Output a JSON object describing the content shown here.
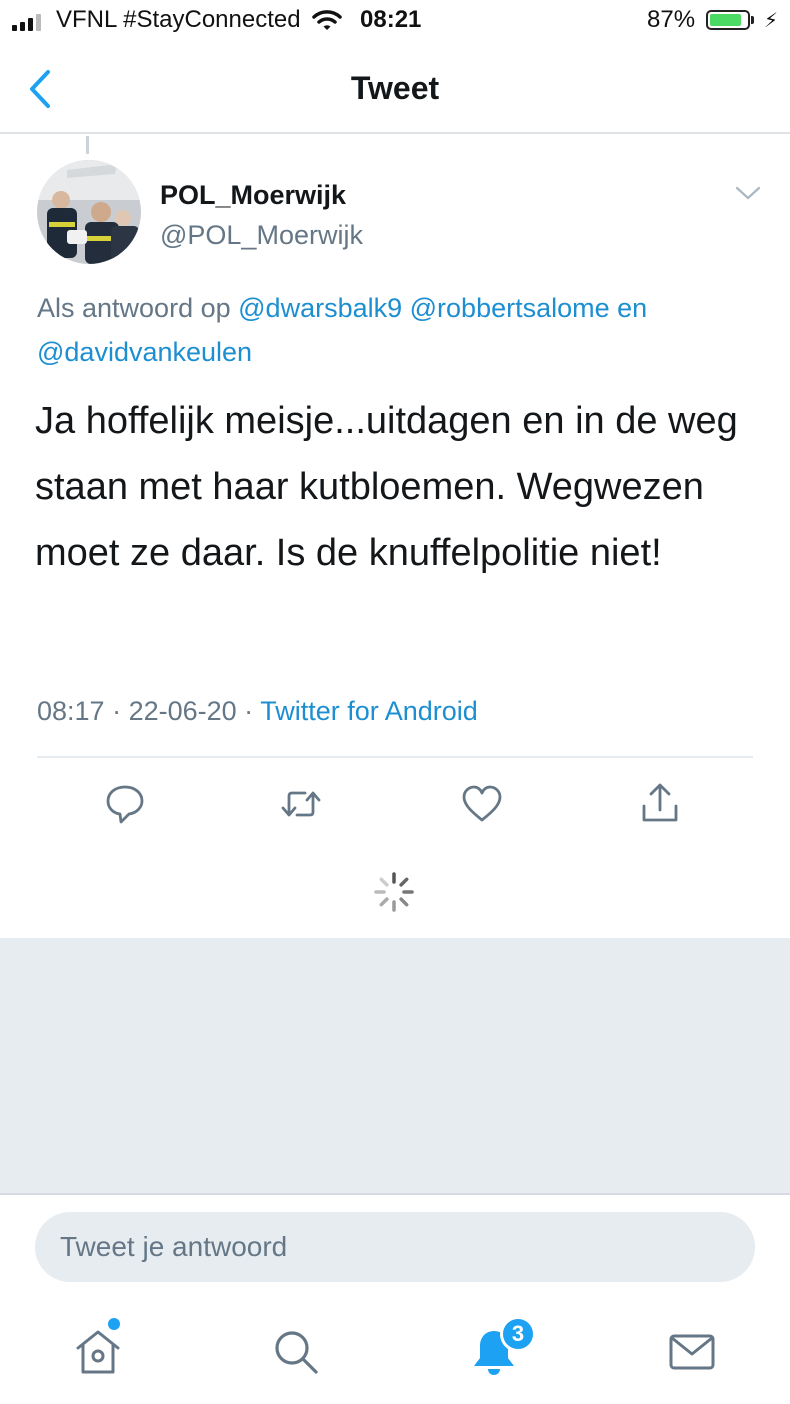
{
  "status_bar": {
    "carrier": "VFNL #StayConnected",
    "time": "08:21",
    "battery_percent": "87%",
    "battery_level": 0.87,
    "battery_color": "#4cd964"
  },
  "nav": {
    "title": "Tweet",
    "back_icon": "chevron-left-icon"
  },
  "tweet": {
    "display_name": "POL_Moerwijk",
    "handle": "@POL_Moerwijk",
    "reply_prefix": "Als antwoord op",
    "mention_1": "@dwarsbalk9",
    "mention_2": "@robbertsalome",
    "reply_conjunction": "en",
    "mention_3": "@davidvankeulen",
    "text": "Ja hoffelijk meisje...uitdagen en in de weg staan met haar kutbloemen. Wegwezen moet ze daar. Is de knuffelpolitie niet!",
    "time": "08:17",
    "separator_1": " · ",
    "date": "22-06-20",
    "separator_2": " · ",
    "source": "Twitter for Android"
  },
  "actions": [
    {
      "icon": "reply-icon"
    },
    {
      "icon": "retweet-icon"
    },
    {
      "icon": "like-icon"
    },
    {
      "icon": "share-icon"
    }
  ],
  "compose": {
    "placeholder": "Tweet je antwoord"
  },
  "tab_bar": {
    "items": [
      {
        "icon": "home-icon"
      },
      {
        "icon": "search-icon"
      },
      {
        "icon": "notifications-icon"
      },
      {
        "icon": "messages-icon"
      }
    ],
    "notification_badge": "3"
  },
  "colors": {
    "accent": "#1da1f2",
    "link": "#1d8fd1",
    "secondary_text": "#657786",
    "background_gray": "#e6ecf0"
  }
}
